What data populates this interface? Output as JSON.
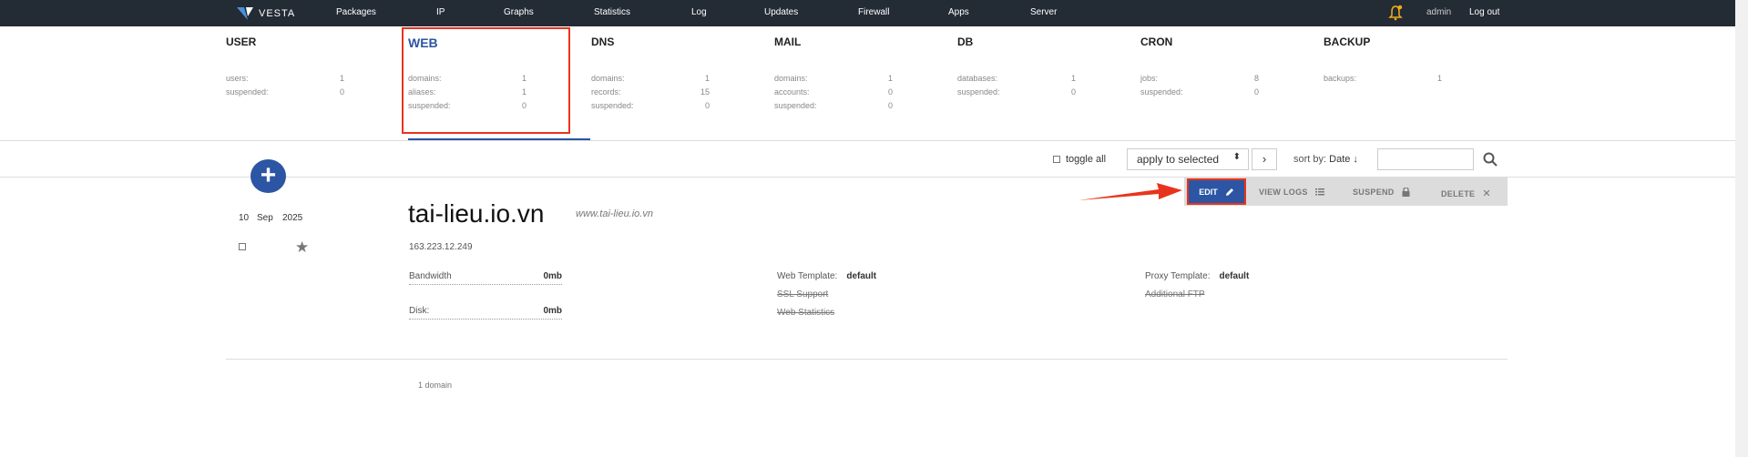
{
  "topbar": {
    "logo": "VESTA",
    "nav": [
      "Packages",
      "IP",
      "Graphs",
      "Statistics",
      "Log",
      "Updates",
      "Firewall",
      "Apps",
      "Server"
    ],
    "user": "admin",
    "logout": "Log out"
  },
  "stats": [
    {
      "title": "USER",
      "rows": [
        [
          "users:",
          "1"
        ],
        [
          "suspended:",
          "0"
        ]
      ]
    },
    {
      "title": "WEB",
      "rows": [
        [
          "domains:",
          "1"
        ],
        [
          "aliases:",
          "1"
        ],
        [
          "suspended:",
          "0"
        ]
      ]
    },
    {
      "title": "DNS",
      "rows": [
        [
          "domains:",
          "1"
        ],
        [
          "records:",
          "15"
        ],
        [
          "suspended:",
          "0"
        ]
      ]
    },
    {
      "title": "MAIL",
      "rows": [
        [
          "domains:",
          "1"
        ],
        [
          "accounts:",
          "0"
        ],
        [
          "suspended:",
          "0"
        ]
      ]
    },
    {
      "title": "DB",
      "rows": [
        [
          "databases:",
          "1"
        ],
        [
          "suspended:",
          "0"
        ]
      ]
    },
    {
      "title": "CRON",
      "rows": [
        [
          "jobs:",
          "8"
        ],
        [
          "suspended:",
          "0"
        ]
      ]
    },
    {
      "title": "BACKUP",
      "rows": [
        [
          "backups:",
          "1"
        ]
      ]
    }
  ],
  "toolbar": {
    "toggle_all": "toggle all",
    "apply_selected": "apply to selected",
    "sort_label": "sort by:",
    "sort_value": "Date ↓"
  },
  "actions": {
    "edit": "EDIT",
    "view_logs": "VIEW LOGS",
    "suspend": "SUSPEND",
    "delete": "DELETE"
  },
  "record": {
    "day": "10",
    "month": "Sep",
    "year": "2025",
    "domain": "tai-lieu.io.vn",
    "alias": "www.tai-lieu.io.vn",
    "ip": "163.223.12.249",
    "bandwidth_label": "Bandwidth",
    "bandwidth_value": "0mb",
    "disk_label": "Disk:",
    "disk_value": "0mb",
    "web_template_label": "Web Template:",
    "web_template_value": "default",
    "proxy_template_label": "Proxy Template:",
    "proxy_template_value": "default",
    "ssl_support": "SSL Support",
    "web_statistics": "Web Statistics",
    "additional_ftp": "Additional FTP"
  },
  "footer": {
    "count": "1 domain"
  },
  "colors": {
    "topbar": "#232b35",
    "accent": "#2c55a4",
    "highlight": "#e8341c"
  }
}
